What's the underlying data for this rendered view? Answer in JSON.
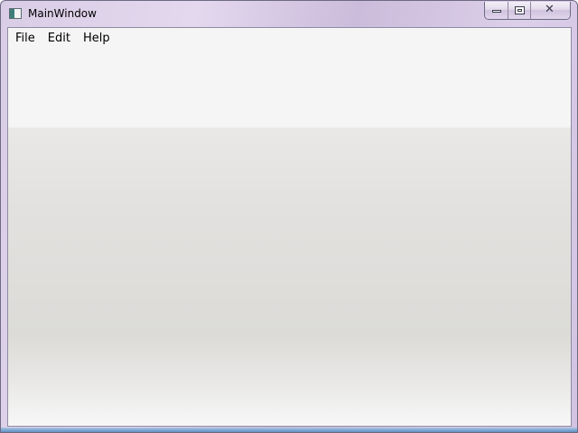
{
  "window": {
    "title": "MainWindow",
    "caption_buttons": {
      "minimize": "minimize",
      "maximize": "maximize",
      "close": "close"
    }
  },
  "menu": {
    "items": [
      {
        "label": "File"
      },
      {
        "label": "Edit"
      },
      {
        "label": "Help"
      }
    ]
  },
  "colors": {
    "client_top": "#f5f5f5",
    "client_mid": "#dcdbd8",
    "frame_tint": "#d9cde6",
    "taskbar_edge": "#5f8fc4"
  }
}
